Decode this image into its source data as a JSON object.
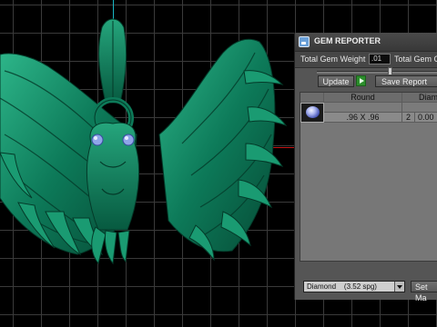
{
  "panel": {
    "title": "GEM REPORTER",
    "total_gem_weight_label": "Total Gem Weight",
    "total_gem_weight_value": ".01",
    "total_gem_count_label": "Total Gem C",
    "update_label": "Update",
    "save_report_label": "Save Report",
    "slider_position": 0.6
  },
  "gem_table": {
    "columns": [
      "Round",
      "Diamo"
    ],
    "rows": [
      {
        "icon": "round-gem-icon",
        "shape": "Round",
        "size": ".96 X .96",
        "count": "2",
        "weight": "0.00"
      }
    ]
  },
  "material": {
    "selected": "Diamond    (3.52 spg)",
    "set_material_label": "Set Ma"
  },
  "colors": {
    "model": "#0e7a5a",
    "axis_y": "#19b6c4",
    "axis_x": "#c41515",
    "grid": "#3a3a3a",
    "eye": "#8fa6e8"
  }
}
